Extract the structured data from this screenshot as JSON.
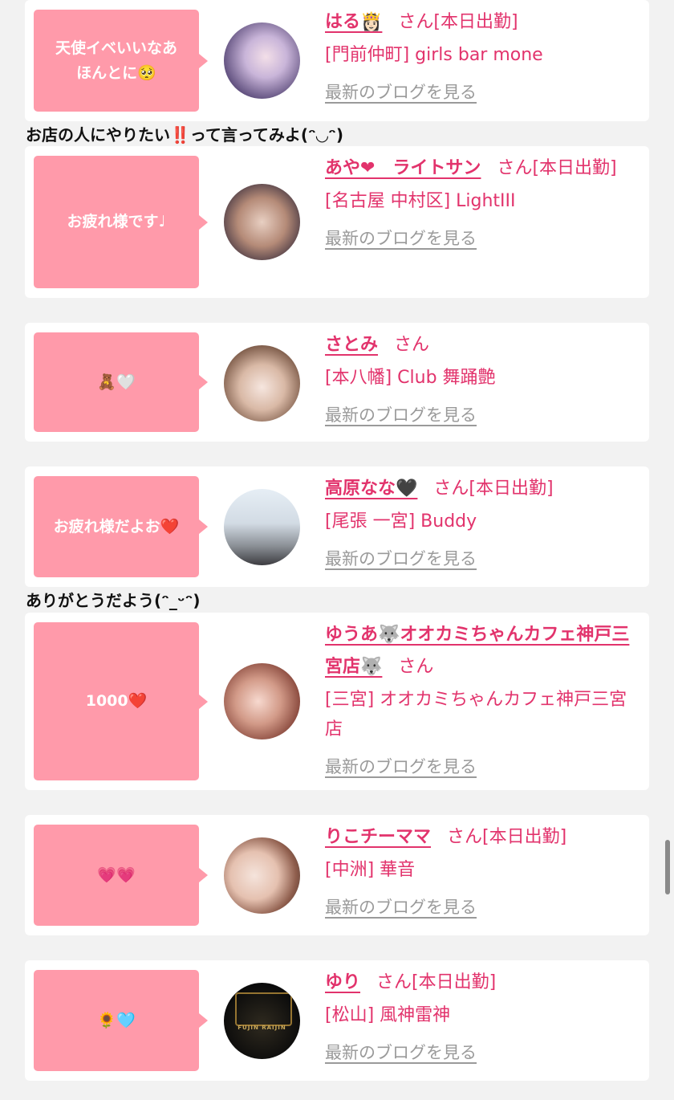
{
  "captions": {
    "c1": "お店の人にやりたい‼️って言ってみよ(ᵔ◡ᵔ)",
    "c2": "ありがとうだよう(ᵔ_ᵕᵔ)"
  },
  "colors": {
    "bubble": "#ff9aaa",
    "accent": "#e2336c",
    "link_gray": "#9a9a9a",
    "background": "#f2f2f2"
  },
  "cards": [
    {
      "message": "天使イベいいなあ\nほんとに🥺",
      "name": "はる👸🏻",
      "suffix": "さん[本日出勤]",
      "shop": "[門前仲町] girls bar mone",
      "blog": "最新のブログを見る"
    },
    {
      "message": "お疲れ様です♩",
      "name": "あや❤︎　ライトサン",
      "suffix": "さん[本日出勤]",
      "shop": "[名古屋 中村区] LightIII",
      "blog": "最新のブログを見る"
    },
    {
      "message": "🧸🤍",
      "name": "さとみ",
      "suffix": "さん",
      "shop": "[本八幡] Club 舞踊艶",
      "blog": "最新のブログを見る"
    },
    {
      "message": "お疲れ様だよお❤️",
      "name": "高原なな🖤",
      "suffix": "さん[本日出勤]",
      "shop": "[尾張 一宮] Buddy",
      "blog": "最新のブログを見る"
    },
    {
      "message": "1000❤️",
      "name": "ゆうあ🐺オオカミちゃんカフェ神戸三宮店🐺",
      "suffix": "さん",
      "shop": "[三宮] オオカミちゃんカフェ神戸三宮店",
      "blog": "最新のブログを見る"
    },
    {
      "message": "💗💗",
      "name": "りこチーママ",
      "suffix": "さん[本日出勤]",
      "shop": "[中洲] 華音",
      "blog": "最新のブログを見る"
    },
    {
      "message": "🌻🩵",
      "name": "ゆり",
      "suffix": "さん[本日出勤]",
      "shop": "[松山] 風神雷神",
      "blog": "最新のブログを見る",
      "avatar_text": "FUJIN RAIJIN"
    }
  ]
}
